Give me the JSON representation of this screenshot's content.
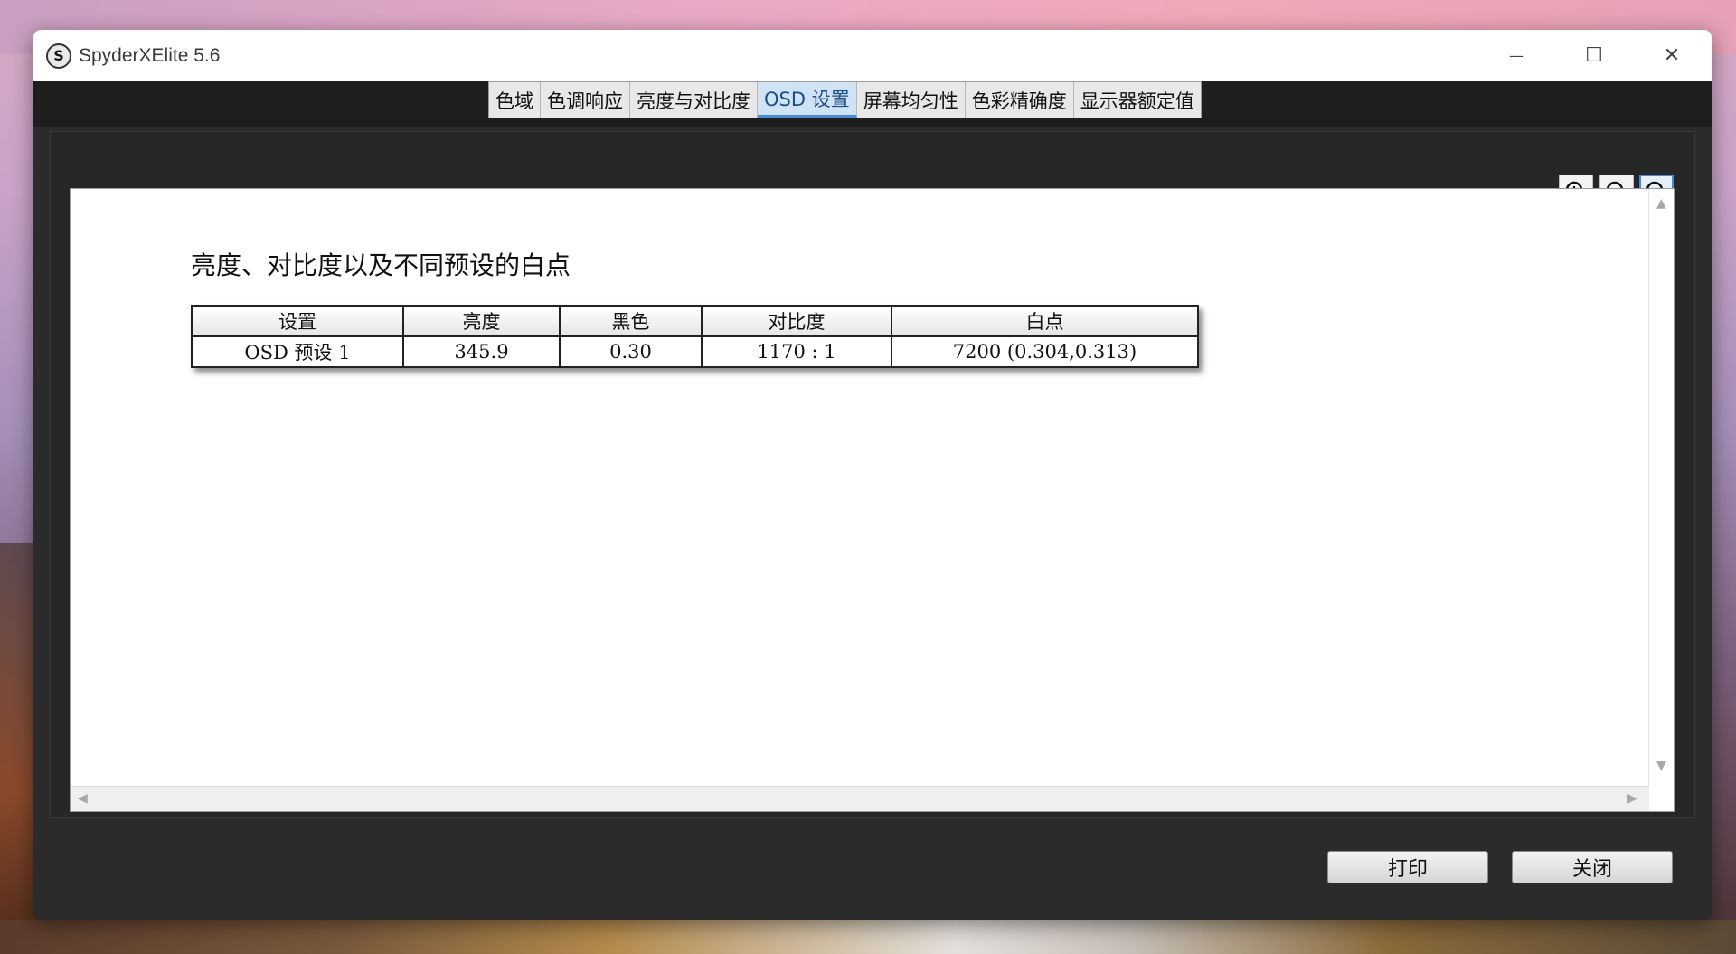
{
  "window": {
    "title": "SpyderXElite 5.6",
    "icon_letter": "S",
    "controls": {
      "minimize": "—",
      "maximize": "☐",
      "close": "✕"
    }
  },
  "tabs": [
    {
      "label": "色域",
      "active": false
    },
    {
      "label": "色调响应",
      "active": false
    },
    {
      "label": "亮度与对比度",
      "active": false
    },
    {
      "label": "OSD 设置",
      "active": true
    },
    {
      "label": "屏幕均匀性",
      "active": false
    },
    {
      "label": "色彩精确度",
      "active": false
    },
    {
      "label": "显示器额定值",
      "active": false
    }
  ],
  "zoom": {
    "in_icon": "zoom-in-icon",
    "out_icon": "zoom-out-icon",
    "fit_icon": "zoom-fit-icon"
  },
  "report": {
    "title": "亮度、对比度以及不同预设的白点",
    "table": {
      "headers": [
        "设置",
        "亮度",
        "黑色",
        "对比度",
        "白点"
      ],
      "rows": [
        [
          "OSD 预设 1",
          "345.9",
          "0.30",
          "1170 : 1",
          "7200 (0.304,0.313)"
        ]
      ]
    }
  },
  "footer": {
    "print_label": "打印",
    "close_label": "关闭"
  },
  "colors": {
    "accent": "#4a8ad4",
    "window_bg": "#2b2b2b",
    "tabbar_bg": "#1e1e1e"
  }
}
